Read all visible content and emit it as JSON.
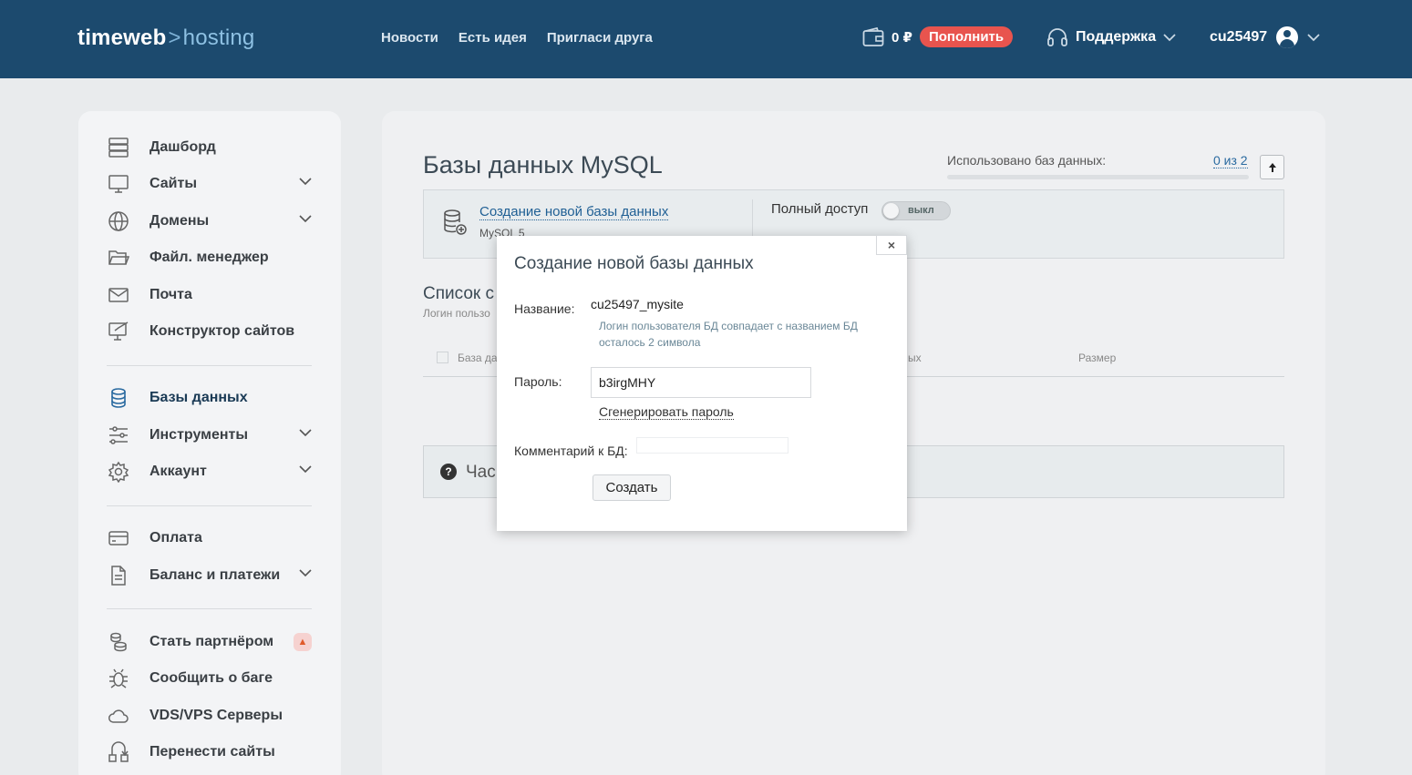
{
  "header": {
    "logo_brand": "timeweb",
    "logo_sep": ">",
    "logo_product": "hosting",
    "nav": [
      "Новости",
      "Есть идея",
      "Пригласи друга"
    ],
    "balance": "0 ₽",
    "topup_label": "Пополнить",
    "support_label": "Поддержка",
    "username": "cu25497"
  },
  "sidebar": {
    "items": [
      {
        "label": "Дашборд",
        "icon": "server-icon"
      },
      {
        "label": "Сайты",
        "icon": "monitor-icon"
      },
      {
        "label": "Домены",
        "icon": "globe-icon"
      },
      {
        "label": "Файл. менеджер",
        "icon": "folder-icon"
      },
      {
        "label": "Почта",
        "icon": "mail-icon"
      },
      {
        "label": "Конструктор сайтов",
        "icon": "builder-icon"
      },
      {
        "label": "Базы данных",
        "icon": "database-icon"
      },
      {
        "label": "Инструменты",
        "icon": "sliders-icon"
      },
      {
        "label": "Аккаунт",
        "icon": "gear-icon"
      },
      {
        "label": "Оплата",
        "icon": "card-icon"
      },
      {
        "label": "Баланс и платежи",
        "icon": "document-icon"
      },
      {
        "label": "Стать партнёром",
        "icon": "coins-icon"
      },
      {
        "label": "Сообщить о баге",
        "icon": "bug-icon"
      },
      {
        "label": "VDS/VPS Серверы",
        "icon": "cloud-icon"
      },
      {
        "label": "Перенести сайты",
        "icon": "transfer-icon"
      }
    ]
  },
  "main": {
    "title": "Базы данных MySQL",
    "used_label": "Использовано баз данных:",
    "used_value": "0 из 2",
    "used_fraction": 0,
    "create_link": "Создание новой базы данных",
    "create_sub": "MySQL 5",
    "access_label": "Полный доступ",
    "toggle_text": "выкл",
    "list_title": "Список с",
    "list_sub": "Логин пользо",
    "col_db": "База да",
    "col_users": "ых",
    "col_size": "Размер",
    "faq_text": "Час"
  },
  "modal": {
    "title": "Создание новой базы данных",
    "name_label": "Название:",
    "name_value": "cu25497_mysite",
    "hint_line1": "Логин пользователя БД совпадает с названием БД",
    "hint_line2": "осталось 2 символа",
    "password_label": "Пароль:",
    "password_value": "b3irgMHY",
    "generate_label": "Сгенерировать пароль",
    "comment_label": "Комментарий к БД:",
    "comment_value": "",
    "create_button": "Создать",
    "close_glyph": "×"
  },
  "colors": {
    "header_bg": "#1c4a6e",
    "topup_bg": "#e8544e",
    "link": "#1f5f94"
  }
}
